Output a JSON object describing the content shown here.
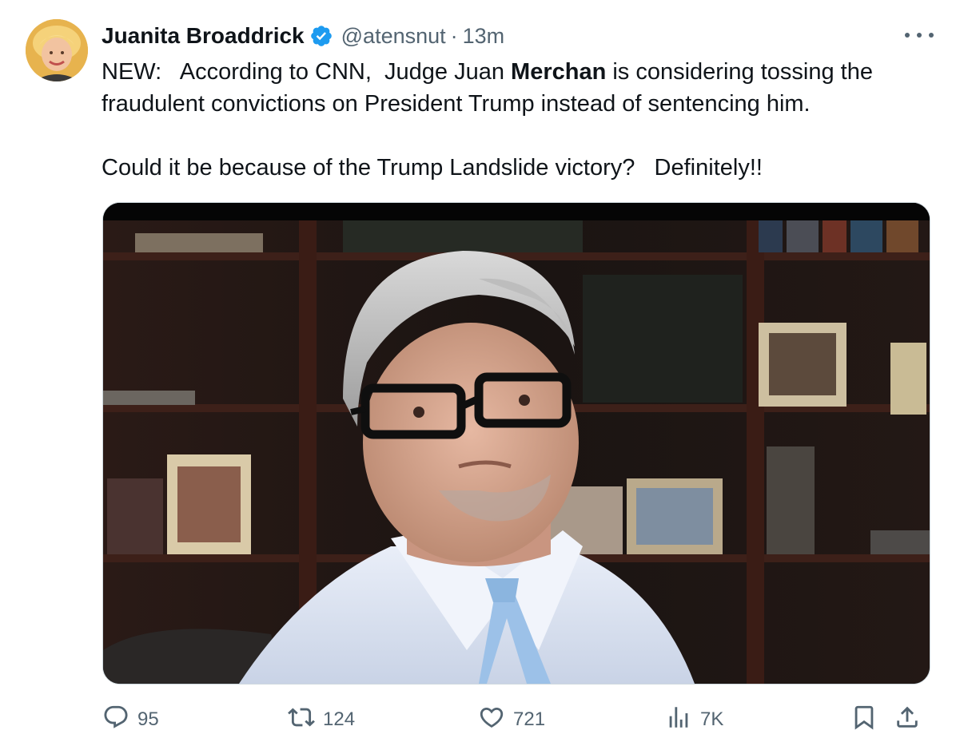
{
  "tweet": {
    "author": {
      "name": "Juanita Broaddrick",
      "handle": "@atensnut",
      "separator": "·",
      "time": "13m"
    },
    "text": {
      "line1_pre": "NEW:   According to CNN,  Judge Juan ",
      "line1_bold": "Merchan",
      "line1_post": " is considering tossing the",
      "line2": "fraudulent convictions on President Trump instead of sentencing him.",
      "line3": "Could it be because of the Trump Landslide victory?   Definitely!!"
    },
    "actions": {
      "replies": "95",
      "reposts": "124",
      "likes": "721",
      "views": "7K"
    },
    "icons": {
      "verified": "verified-badge-icon",
      "more": "more-dots-icon",
      "reply": "reply-icon",
      "repost": "repost-icon",
      "like": "heart-icon",
      "views": "views-chart-icon",
      "bookmark": "bookmark-icon",
      "share": "share-icon"
    },
    "colors": {
      "text": "#0f1419",
      "secondary": "#536471",
      "verified": "#1d9bf0",
      "border": "#cfd9de"
    }
  }
}
